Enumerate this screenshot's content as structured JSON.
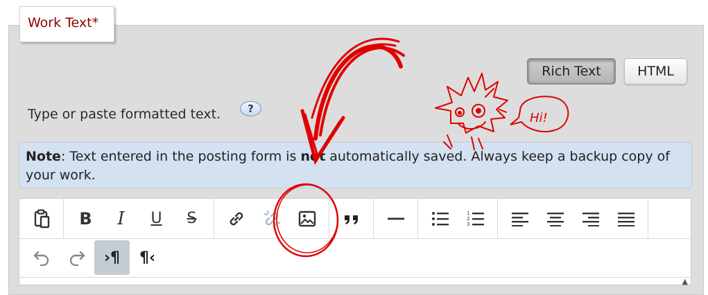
{
  "section": {
    "legend": "Work Text*"
  },
  "mode_buttons": {
    "rich_text": "Rich Text",
    "html": "HTML"
  },
  "hint": {
    "text": "Type or paste formatted text.",
    "help": "?"
  },
  "note": {
    "label": "Note",
    "before": ": Text entered in the posting form is ",
    "emphasis": "not",
    "after": " automatically saved. Always keep a backup copy of your work."
  },
  "annotation": {
    "speech": "Hi!",
    "color": "#e00000"
  },
  "toolbar": {
    "row1_groups": [
      [
        "paste-icon"
      ],
      [
        "bold-icon",
        "italic-icon",
        "underline-icon",
        "strikethrough-icon"
      ],
      [
        "link-icon",
        "unlink-icon",
        "image-icon"
      ],
      [
        "blockquote-icon"
      ],
      [
        "horizontal-rule-icon"
      ],
      [
        "bullet-list-icon",
        "numbered-list-icon"
      ],
      [
        "align-left-icon",
        "align-center-icon",
        "align-right-icon",
        "align-justify-icon"
      ]
    ],
    "row2": [
      "undo-icon",
      "redo-icon",
      "ltr-icon",
      "rtl-icon"
    ],
    "glyphs": {
      "bold": "B",
      "italic": "I",
      "underline": "U",
      "strike": "S",
      "ltr": "›¶",
      "rtl": "¶‹"
    }
  }
}
